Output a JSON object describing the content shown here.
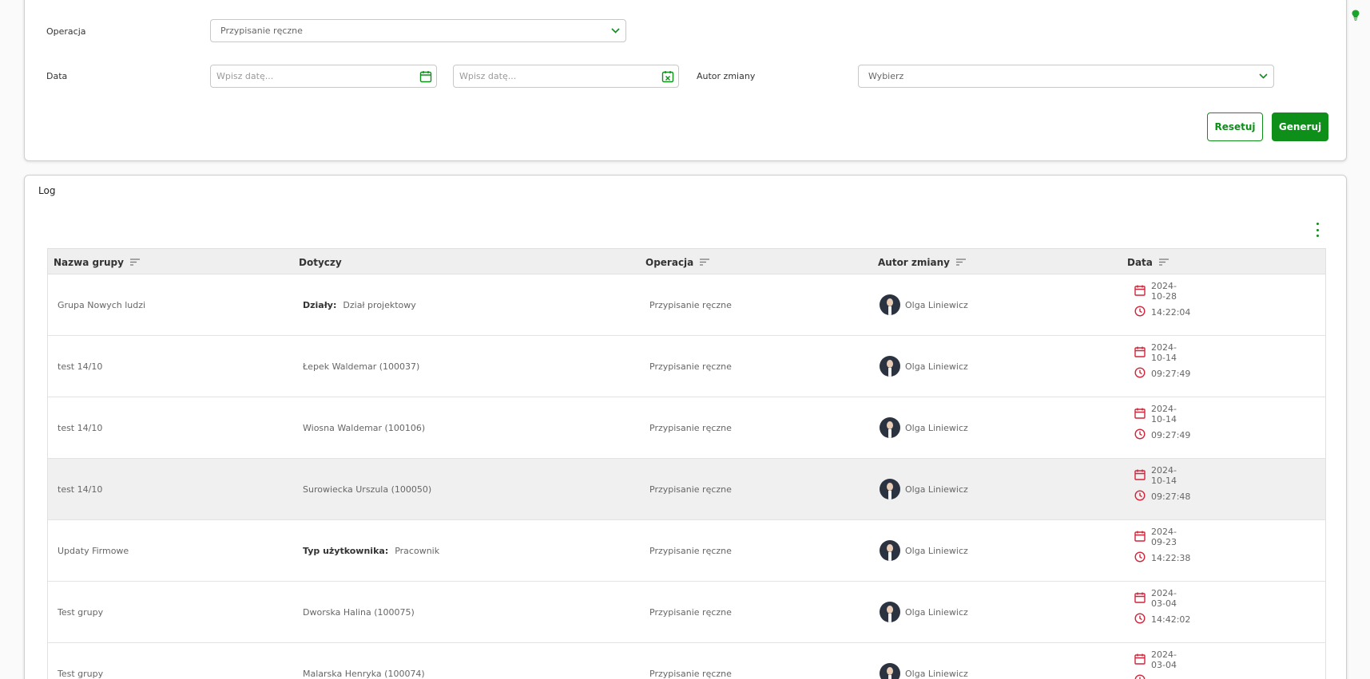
{
  "filters": {
    "operation_label": "Operacja",
    "operation_value": "Przypisanie ręczne",
    "date_label": "Data",
    "date_from_placeholder": "Wpisz datę...",
    "date_to_placeholder": "Wpisz datę...",
    "author_label": "Autor zmiany",
    "author_placeholder": "Wybierz",
    "reset_label": "Resetuj",
    "generate_label": "Generuj"
  },
  "log": {
    "title": "Log",
    "columns": {
      "group": "Nazwa grupy",
      "concerns": "Dotyczy",
      "operation": "Operacja",
      "author": "Autor zmiany",
      "date": "Data"
    },
    "rows": [
      {
        "group": "Grupa Nowych ludzi",
        "concerns_key": "Działy:",
        "concerns": "Dział projektowy",
        "operation": "Przypisanie ręczne",
        "author": "Olga Liniewicz",
        "date": "2024-10-28",
        "time": "14:22:04"
      },
      {
        "group": "test 14/10",
        "concerns_key": "",
        "concerns": "Łepek Waldemar (100037)",
        "operation": "Przypisanie ręczne",
        "author": "Olga Liniewicz",
        "date": "2024-10-14",
        "time": "09:27:49"
      },
      {
        "group": "test 14/10",
        "concerns_key": "",
        "concerns": "Wiosna Waldemar (100106)",
        "operation": "Przypisanie ręczne",
        "author": "Olga Liniewicz",
        "date": "2024-10-14",
        "time": "09:27:49"
      },
      {
        "group": "test 14/10",
        "concerns_key": "",
        "concerns": "Surowiecka Urszula (100050)",
        "operation": "Przypisanie ręczne",
        "author": "Olga Liniewicz",
        "date": "2024-10-14",
        "time": "09:27:48"
      },
      {
        "group": "Updaty Firmowe",
        "concerns_key": "Typ użytkownika:",
        "concerns": "Pracownik",
        "operation": "Przypisanie ręczne",
        "author": "Olga Liniewicz",
        "date": "2024-09-23",
        "time": "14:22:38"
      },
      {
        "group": "Test grupy",
        "concerns_key": "",
        "concerns": "Dworska Halina (100075)",
        "operation": "Przypisanie ręczne",
        "author": "Olga Liniewicz",
        "date": "2024-03-04",
        "time": "14:42:02"
      },
      {
        "group": "Test grupy",
        "concerns_key": "",
        "concerns": "Malarska Henryka (100074)",
        "operation": "Przypisanie ręczne",
        "author": "Olga Liniewicz",
        "date": "2024-03-04",
        "time": ""
      }
    ]
  },
  "colors": {
    "accent": "#0e8f1a",
    "calendar": "#d2243a"
  },
  "icons": [
    "chevron-down-icon",
    "calendar-icon",
    "calendar-clear-icon",
    "sort-icon",
    "clock-icon",
    "more-vertical-icon",
    "lightbulb-icon"
  ]
}
